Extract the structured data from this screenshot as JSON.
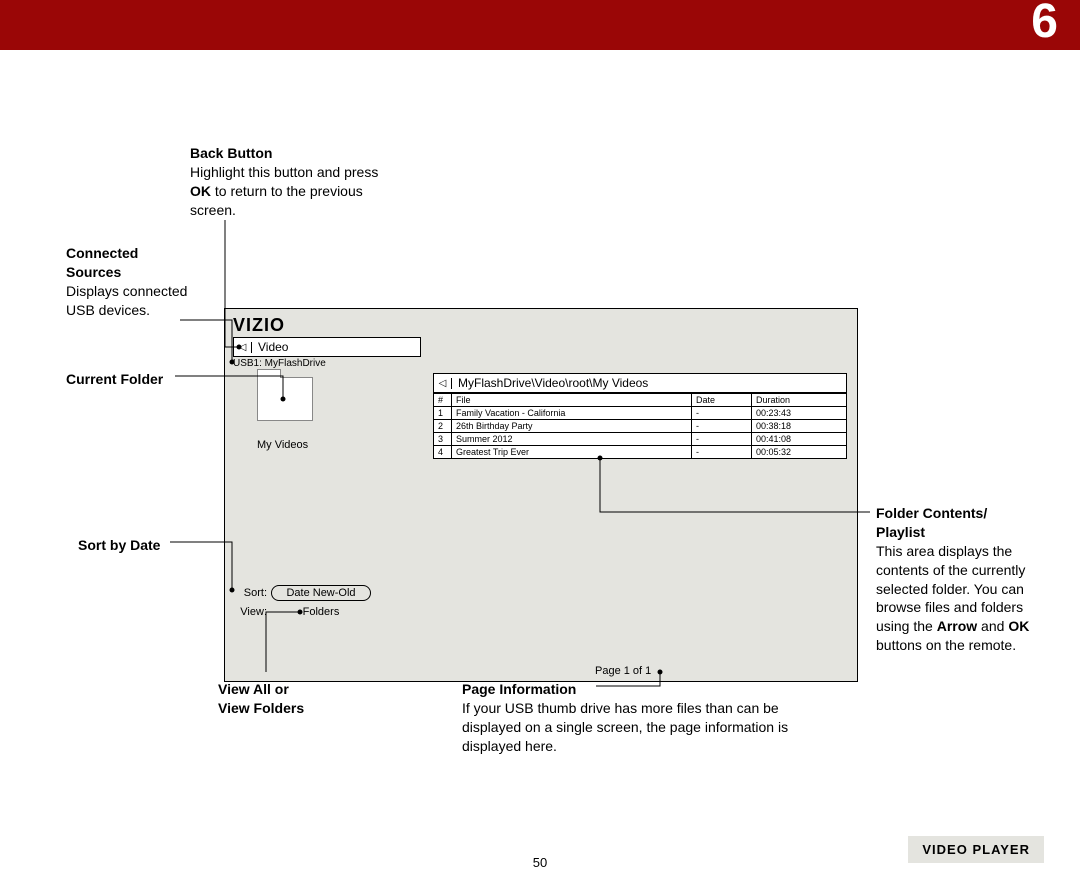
{
  "chapter": "6",
  "page_number": "50",
  "section_label": "VIDEO PLAYER",
  "screenshot": {
    "logo": "VIZIO",
    "tab_label": "Video",
    "source": "USB1: MyFlashDrive",
    "folder_label": "My Videos",
    "sort_label": "Sort:",
    "sort_value": "Date New-Old",
    "view_label": "View:",
    "view_value": "Folders",
    "path": "MyFlashDrive\\Video\\root\\My Videos",
    "page_info": "Page 1 of 1",
    "table": {
      "headers": {
        "num": "#",
        "file": "File",
        "date": "Date",
        "duration": "Duration"
      },
      "rows": [
        {
          "num": "1",
          "file": "Family Vacation - California",
          "date": "-",
          "duration": "00:23:43"
        },
        {
          "num": "2",
          "file": "26th Birthday Party",
          "date": "-",
          "duration": "00:38:18"
        },
        {
          "num": "3",
          "file": "Summer 2012",
          "date": "-",
          "duration": "00:41:08"
        },
        {
          "num": "4",
          "file": "Greatest Trip Ever",
          "date": "-",
          "duration": "00:05:32"
        }
      ]
    }
  },
  "callouts": {
    "back_button": {
      "title": "Back Button",
      "body_pre": "Highlight this button and press ",
      "bold": "OK",
      "body_post": " to return to the previous screen."
    },
    "connected_sources": {
      "title_l1": "Connected",
      "title_l2": "Sources",
      "body": "Displays connected USB devices."
    },
    "current_folder": {
      "title": "Current Folder"
    },
    "sort_by_date": {
      "title": "Sort by Date"
    },
    "view_all": {
      "title_l1": "View All or",
      "title_l2": "View Folders"
    },
    "page_info": {
      "title": "Page Information",
      "body": "If your USB thumb drive has more files than can be displayed on a single screen, the page information is displayed here."
    },
    "folder_contents": {
      "title_l1": "Folder Contents/",
      "title_l2": "Playlist",
      "body_pre": "This area displays the contents of the currently selected folder. You can browse files and folders using the ",
      "bold1": "Arrow",
      "mid": " and ",
      "bold2": "OK",
      "body_post": " buttons on the remote."
    }
  }
}
